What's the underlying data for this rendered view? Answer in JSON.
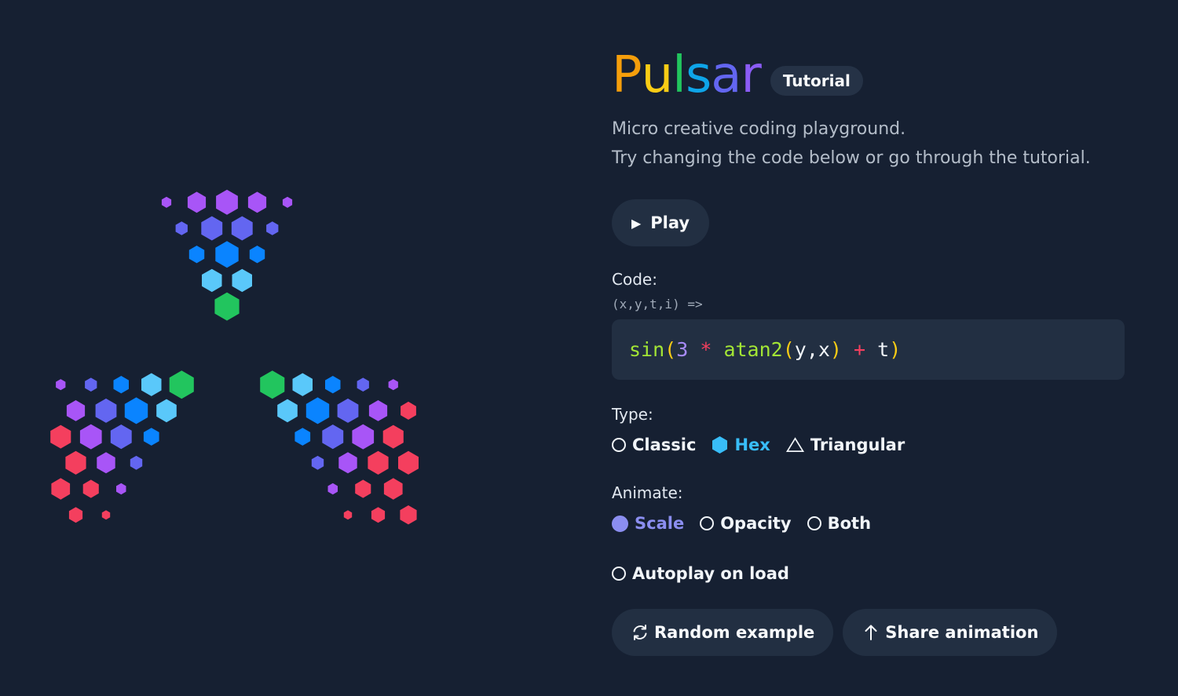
{
  "brand": {
    "title_letters": [
      "P",
      "u",
      "l",
      "s",
      "a",
      "r"
    ],
    "title_colors": [
      "#f59e0b",
      "#facc15",
      "#22c55e",
      "#0ea5e9",
      "#6366f1",
      "#8b5cf6"
    ],
    "badge": "Tutorial"
  },
  "subtitle": {
    "line1": "Micro creative coding playground.",
    "line2": "Try changing the code below or go through the tutorial."
  },
  "play": {
    "icon": "play-icon",
    "label": "Play"
  },
  "code": {
    "label": "Code:",
    "signature": "(x,y,t,i) =>",
    "tokens": {
      "fn1": "sin",
      "p1": "(",
      "n1": "3",
      "op1": " * ",
      "fn2": "atan2",
      "p2": "(",
      "v1": "y,x",
      "p3": ")",
      "op2": " + ",
      "v2": "t",
      "p4": ")"
    }
  },
  "type": {
    "label": "Type:",
    "options": [
      {
        "label": "Classic",
        "icon": "radio-circle-icon",
        "selected": false
      },
      {
        "label": "Hex",
        "icon": "hexagon-icon",
        "selected": true
      },
      {
        "label": "Triangular",
        "icon": "triangle-icon",
        "selected": false
      }
    ]
  },
  "animate": {
    "label": "Animate:",
    "options": [
      {
        "label": "Scale",
        "selected": true
      },
      {
        "label": "Opacity",
        "selected": false
      },
      {
        "label": "Both",
        "selected": false
      }
    ]
  },
  "autoplay": {
    "label": "Autoplay on load",
    "checked": false
  },
  "actions": {
    "random": {
      "icon": "refresh-icon",
      "label": "Random example"
    },
    "share": {
      "icon": "arrow-up-icon",
      "label": "Share animation"
    }
  },
  "colors": {
    "background": "#162032",
    "surface": "#222f42",
    "accent_cyan": "#38bdf8",
    "accent_violet": "#8b8ef0"
  }
}
